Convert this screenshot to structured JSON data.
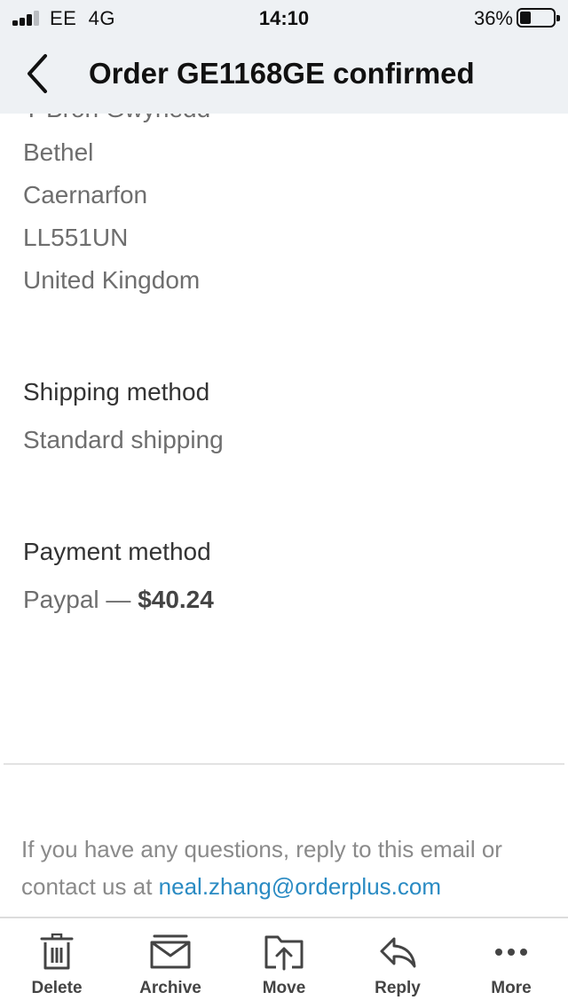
{
  "status_bar": {
    "carrier": "EE",
    "network": "4G",
    "time": "14:10",
    "battery_percent": "36%"
  },
  "header": {
    "title": "Order GE1168GE confirmed"
  },
  "address": {
    "lines": [
      "Y Bron Gwynedd",
      "Bethel",
      "Caernarfon",
      "LL551UN",
      "United Kingdom"
    ]
  },
  "shipping": {
    "heading": "Shipping method",
    "value": "Standard shipping"
  },
  "payment": {
    "heading": "Payment method",
    "method": "Paypal",
    "separator": " — ",
    "amount": "$40.24"
  },
  "footer": {
    "text": "If you have any questions, reply to this email or contact us at",
    "email": "neal.zhang@orderplus.com"
  },
  "toolbar": {
    "items": [
      {
        "label": "Delete",
        "icon": "trash-icon"
      },
      {
        "label": "Archive",
        "icon": "archive-icon"
      },
      {
        "label": "Move",
        "icon": "move-folder-icon"
      },
      {
        "label": "Reply",
        "icon": "reply-icon"
      },
      {
        "label": "More",
        "icon": "more-dots-icon"
      }
    ]
  },
  "colors": {
    "header_bg": "#eef1f4",
    "link": "#2a8bc3",
    "muted_text": "#6e6e6e"
  }
}
